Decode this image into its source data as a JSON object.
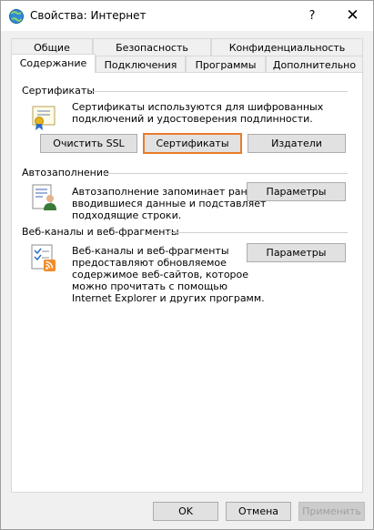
{
  "window": {
    "title": "Свойства: Интернет",
    "help": "?",
    "close": "✕"
  },
  "tabs_row1": [
    "Общие",
    "Безопасность",
    "Конфиденциальность"
  ],
  "tabs_row2": [
    "Содержание",
    "Подключения",
    "Программы",
    "Дополнительно"
  ],
  "active_tab": "Содержание",
  "certificates": {
    "heading": "Сертификаты",
    "desc_line1": "Сертификаты используются для шифрованных",
    "desc_line2": "подключений и удостоверения подлинности.",
    "clear_ssl": "Очистить SSL",
    "certs_btn": "Сертификаты",
    "publishers": "Издатели"
  },
  "autocomplete": {
    "heading": "Автозаполнение",
    "desc_line1": "Автозаполнение запоминает ранее",
    "desc_line2": "вводившиеся данные и подставляет",
    "desc_line3": "подходящие строки.",
    "settings": "Параметры"
  },
  "feeds": {
    "heading": "Веб-каналы и веб-фрагменты",
    "desc_line1": "Веб-каналы и веб-фрагменты",
    "desc_line2": "предоставляют обновляемое",
    "desc_line3": "содержимое веб-сайтов, которое",
    "desc_line4": "можно прочитать с помощью",
    "desc_line5": "Internet Explorer и других программ.",
    "settings": "Параметры"
  },
  "footer": {
    "ok": "OK",
    "cancel": "Отмена",
    "apply": "Применить"
  },
  "colors": {
    "focus": "#e87b2a",
    "button_bg": "#e1e1e1"
  }
}
